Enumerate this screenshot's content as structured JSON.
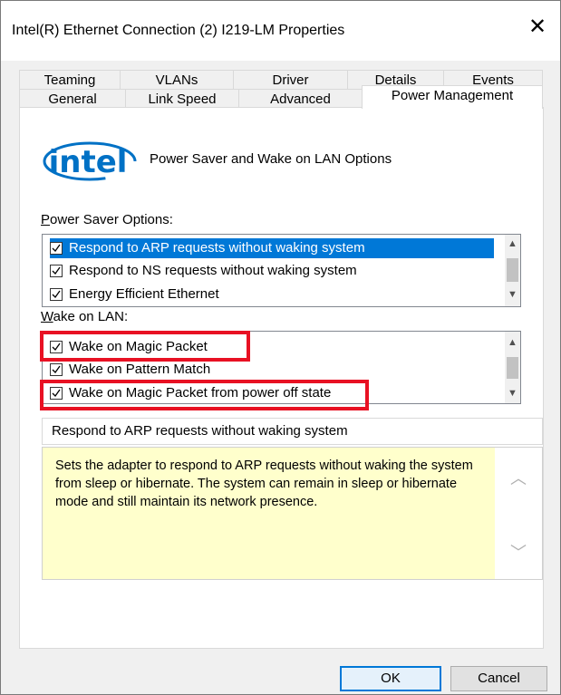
{
  "window": {
    "title": "Intel(R) Ethernet Connection (2) I219-LM Properties",
    "close_glyph": "✕"
  },
  "tabs": {
    "row1": [
      "Teaming",
      "VLANs",
      "Driver",
      "Details",
      "Events"
    ],
    "row2": [
      "General",
      "Link Speed",
      "Advanced",
      "Power Management"
    ],
    "active": "Power Management"
  },
  "header": {
    "logo_text": "intel",
    "text": "Power Saver and Wake on LAN Options"
  },
  "power_saver": {
    "label_underlined": "P",
    "label_rest": "ower Saver Options:",
    "items": [
      {
        "label": "Respond to ARP requests without waking system",
        "checked": true,
        "selected": true
      },
      {
        "label": "Respond to NS requests without waking system",
        "checked": true,
        "selected": false
      },
      {
        "label": "Energy Efficient Ethernet",
        "checked": true,
        "selected": false
      }
    ]
  },
  "wake_on_lan": {
    "label_underlined": "W",
    "label_rest": "ake on LAN:",
    "items": [
      {
        "label": "Wake on Magic Packet",
        "checked": true
      },
      {
        "label": "Wake on Pattern Match",
        "checked": true
      },
      {
        "label": "Wake on Magic Packet from power off state",
        "checked": true
      }
    ]
  },
  "status_text": "Respond to ARP requests without waking system",
  "description": "Sets the adapter to respond to ARP requests without waking the system from sleep or hibernate. The system can remain in sleep or hibernate mode and still maintain its network presence.",
  "buttons": {
    "ok": "OK",
    "cancel": "Cancel"
  },
  "colors": {
    "selection": "#0078d7",
    "highlight_box": "#e81123",
    "description_bg": "#ffffcc",
    "intel_logo": "#0071c5"
  },
  "icons": {
    "close": "close-icon",
    "checkbox": "checkmark-icon",
    "scroll_up": "chevron-up-icon",
    "scroll_down": "chevron-down-icon"
  }
}
